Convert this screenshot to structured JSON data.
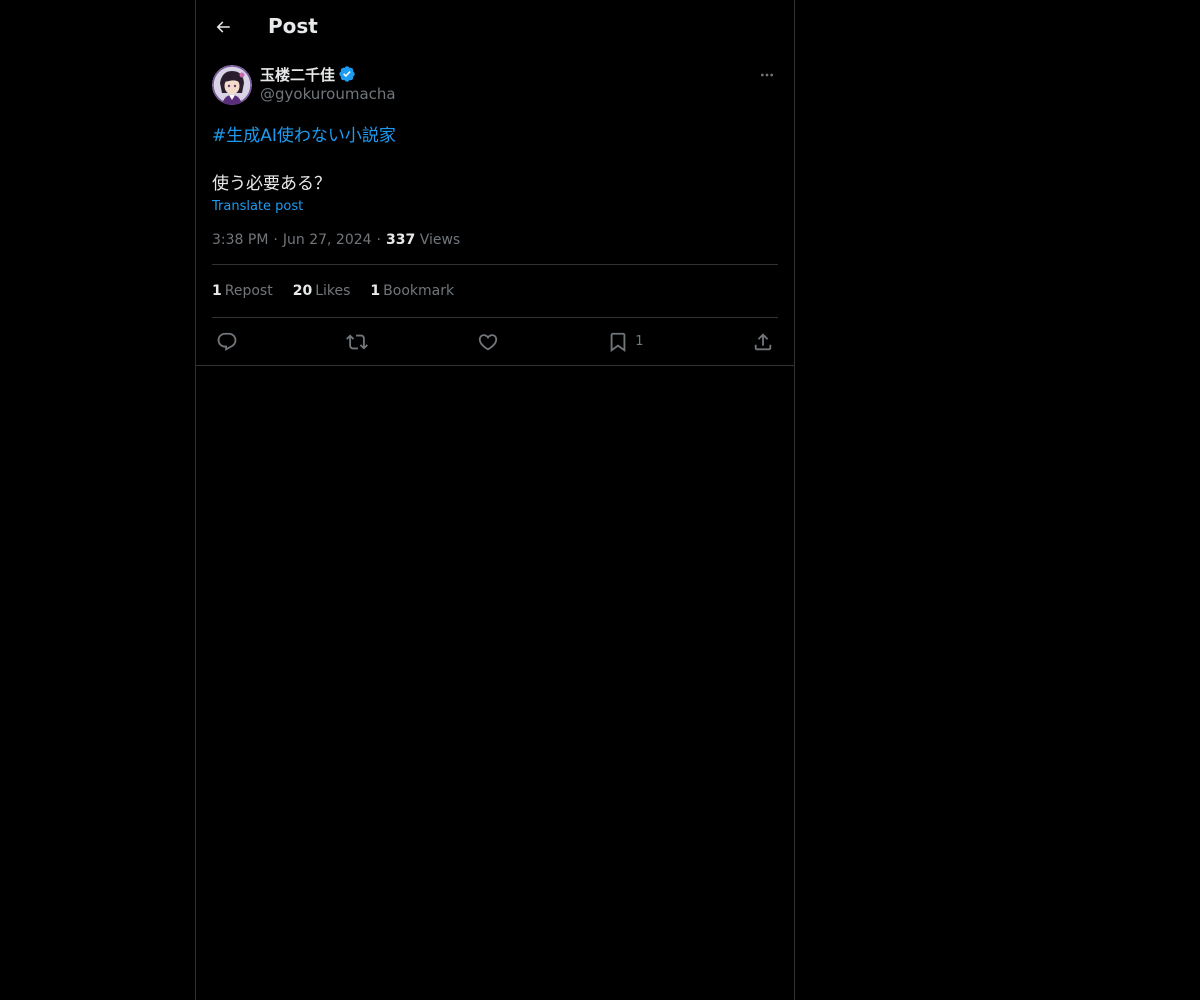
{
  "header": {
    "title": "Post",
    "back_icon": "arrow-left-icon"
  },
  "author": {
    "name": "玉楼二千佳",
    "handle": "@gyokuroumacha",
    "verified": true,
    "verified_color": "#1d9bf0"
  },
  "post": {
    "hashtag": "#生成AI使わない小説家",
    "text": "使う必要ある？",
    "translate_label": "Translate post",
    "time": "3:38 PM",
    "date": "Jun 27, 2024",
    "views_count": "337",
    "views_label": "Views",
    "separator": "·"
  },
  "stats": [
    {
      "count": "1",
      "label": "Repost"
    },
    {
      "count": "20",
      "label": "Likes"
    },
    {
      "count": "1",
      "label": "Bookmark"
    }
  ],
  "actions": {
    "reply_icon": "reply-icon",
    "repost_icon": "repost-icon",
    "like_icon": "heart-icon",
    "bookmark_icon": "bookmark-icon",
    "bookmark_count": "1",
    "share_icon": "share-icon"
  },
  "colors": {
    "background": "#000000",
    "text": "#e7e9ea",
    "muted": "#71767b",
    "accent": "#1d9bf0",
    "border": "#2f3336"
  }
}
